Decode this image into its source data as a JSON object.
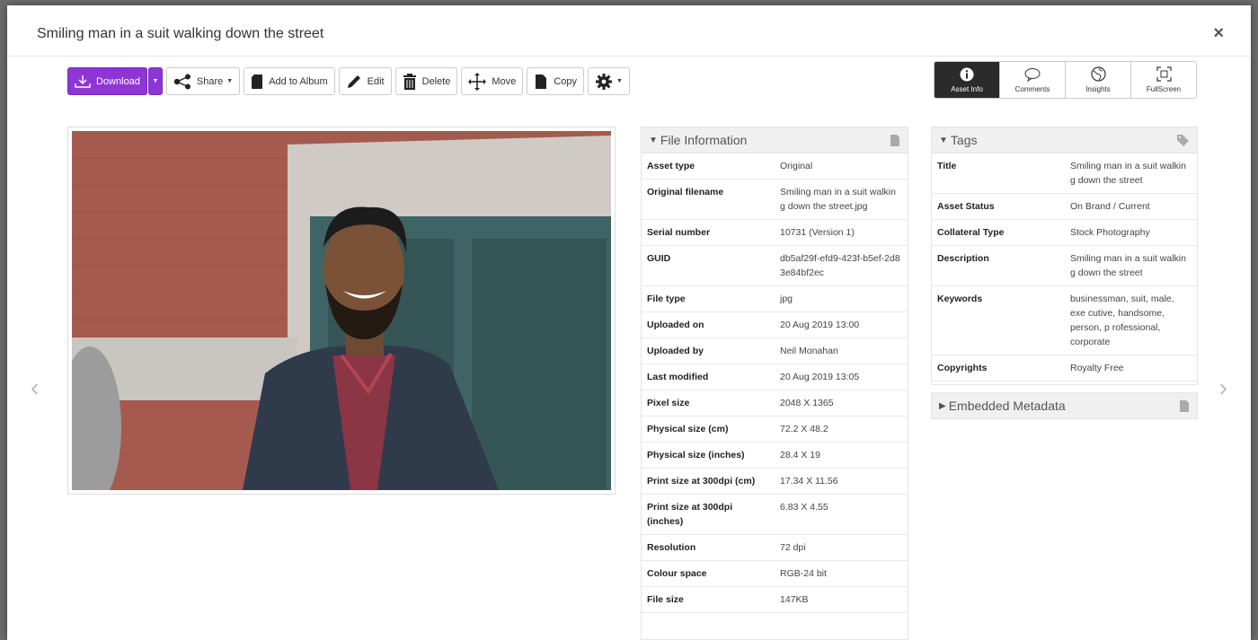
{
  "modal": {
    "title": "Smiling man in a suit walking down the street",
    "close_glyph": "×"
  },
  "toolbar": {
    "download": "Download",
    "share": "Share",
    "add_to_album": "Add to Album",
    "edit": "Edit",
    "delete": "Delete",
    "move": "Move",
    "copy": "Copy"
  },
  "view_tabs": [
    {
      "label": "Asset Info",
      "icon": "info-icon",
      "active": true
    },
    {
      "label": "Comments",
      "icon": "comment-icon",
      "active": false
    },
    {
      "label": "Insights",
      "icon": "globe-icon",
      "active": false
    },
    {
      "label": "FullScreen",
      "icon": "fullscreen-icon",
      "active": false
    }
  ],
  "navigation": {
    "prev": "‹",
    "next": "›"
  },
  "file_information": {
    "heading": "File Information",
    "rows": [
      {
        "label": "Asset type",
        "value": "Original"
      },
      {
        "label": "Original filename",
        "value": "Smiling man in a suit walkin g down the street.jpg"
      },
      {
        "label": "Serial number",
        "value": "10731 (Version 1)"
      },
      {
        "label": "GUID",
        "value": "db5af29f-efd9-423f-b5ef-2d8 3e84bf2ec"
      },
      {
        "label": "File type",
        "value": "jpg"
      },
      {
        "label": "Uploaded on",
        "value": "20 Aug 2019 13:00"
      },
      {
        "label": "Uploaded by",
        "value": "Neil Monahan"
      },
      {
        "label": "Last modified",
        "value": "20 Aug 2019 13:05"
      },
      {
        "label": "Pixel size",
        "value": "2048 X 1365"
      },
      {
        "label": "Physical size (cm)",
        "value": "72.2 X 48.2"
      },
      {
        "label": "Physical size (inches)",
        "value": "28.4 X 19"
      },
      {
        "label": "Print size at 300dpi (cm)",
        "value": "17.34 X 11.56"
      },
      {
        "label": "Print size at 300dpi (inches)",
        "value": "6.83 X 4.55"
      },
      {
        "label": "Resolution",
        "value": "72 dpi"
      },
      {
        "label": "Colour space",
        "value": "RGB-24 bit"
      },
      {
        "label": "File size",
        "value": "147KB"
      }
    ]
  },
  "tags": {
    "heading": "Tags",
    "rows": [
      {
        "label": "Title",
        "value": "Smiling man in a suit walkin g down the street"
      },
      {
        "label": "Asset Status",
        "value": "On Brand / Current"
      },
      {
        "label": "Collateral Type",
        "value": "Stock Photography"
      },
      {
        "label": "Description",
        "value": "Smiling man in a suit walkin g down the street"
      },
      {
        "label": "Keywords",
        "value": "businessman, suit, male, exe cutive, handsome, person, p rofessional, corporate"
      },
      {
        "label": "Copyrights",
        "value": "Royalty Free"
      }
    ]
  },
  "embedded_metadata": {
    "heading": "Embedded Metadata"
  },
  "colors": {
    "accent": "#8e35d6",
    "active_tab": "#2b2b2b"
  }
}
